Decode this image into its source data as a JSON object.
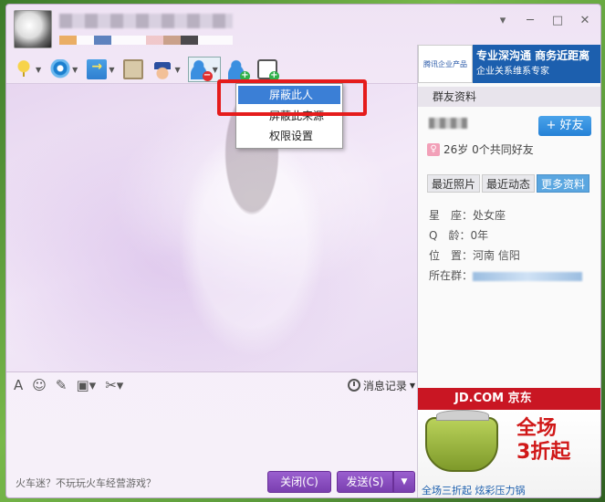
{
  "window": {
    "controls": {
      "menu": "▾",
      "minimize": "─",
      "maximize": "□",
      "close": "✕"
    }
  },
  "toolbar": {
    "items": [
      {
        "name": "microphone",
        "icon": "microphone-icon"
      },
      {
        "name": "camera",
        "icon": "camera-icon"
      },
      {
        "name": "send-file",
        "icon": "folder-send-icon"
      },
      {
        "name": "remote-desktop",
        "icon": "screen-icon"
      },
      {
        "name": "police",
        "icon": "police-icon"
      },
      {
        "name": "block-user",
        "icon": "user-remove-icon"
      },
      {
        "name": "add-friend",
        "icon": "user-add-icon"
      },
      {
        "name": "create-discussion",
        "icon": "message-add-icon"
      }
    ]
  },
  "dropdown_menu": {
    "items": [
      "屏蔽此人",
      "屏蔽此来源",
      "权限设置"
    ],
    "selected_index": 0
  },
  "input_toolbar": {
    "history_label": "消息记录"
  },
  "bottom_bar": {
    "promo_text": "火车迷？不玩玩火车经营游戏？",
    "close_label": "关闭(C)",
    "send_label": "发送(S)"
  },
  "right_panel": {
    "ad_top": {
      "logo_text": "腾讯企业产品",
      "line1": "专业深沟通 商务近距离",
      "line2": "企业关系维系专家"
    },
    "section_title": "群友资料",
    "add_friend_label": "+ 好友",
    "friend_info": "26岁 0个共同好友",
    "tabs": [
      "最近照片",
      "最近动态",
      "更多资料"
    ],
    "active_tab": 2,
    "profile": {
      "constellation_label": "星　座：",
      "constellation": "处女座",
      "qage_label": "Q　龄：",
      "qage": "0年",
      "location_label": "位　置：",
      "location": "河南 信阳",
      "group_label": "所在群："
    },
    "ad_bottom": {
      "brand": "JD.COM 京东",
      "headline1": "全场",
      "headline2": "3折起",
      "footer": "全场三折起 炫彩压力锅"
    }
  },
  "colors": {
    "accent_purple": "#7a3fb0",
    "highlight_red": "#e51c1c",
    "menu_selected": "#3b7fd6",
    "add_friend_blue": "#2581d6",
    "jd_red": "#c91623"
  }
}
